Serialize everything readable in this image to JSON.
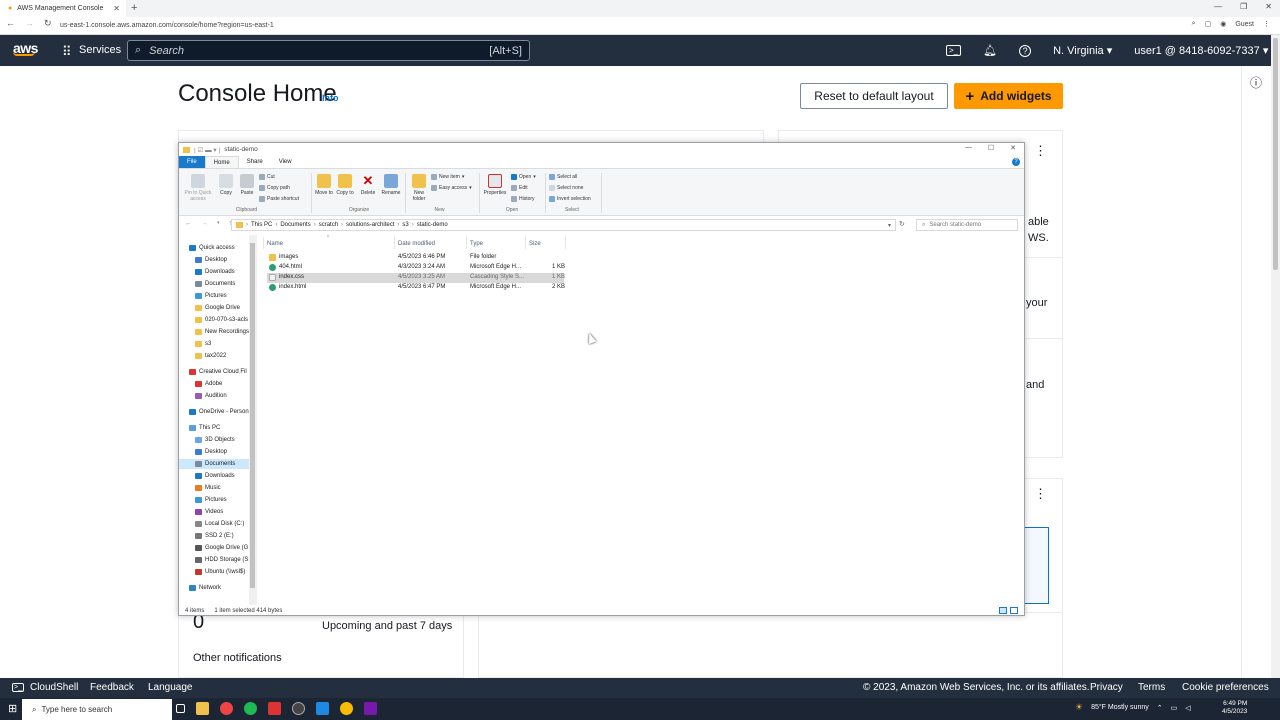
{
  "browser": {
    "tab_title": "AWS Management Console",
    "url": "us-east-1.console.aws.amazon.com/console/home?region=us-east-1",
    "profile": "Guest"
  },
  "aws_nav": {
    "logo": "aws",
    "services": "Services",
    "search_placeholder": "Search",
    "search_shortcut": "[Alt+S]",
    "region": "N. Virginia",
    "account": "user1 @ 8418-6092-7337"
  },
  "console": {
    "title": "Console Home",
    "info": "Info",
    "reset_button": "Reset to default layout",
    "add_widgets_button": "Add widgets",
    "fragment_1a": "able",
    "fragment_1b": "WS.",
    "fragment_2": "your",
    "fragment_3": "and",
    "health_count": "0",
    "upcoming": "Upcoming and past 7 days",
    "other_notifications": "Other notifications"
  },
  "footer": {
    "cloudshell": "CloudShell",
    "feedback": "Feedback",
    "language": "Language",
    "copyright": "© 2023, Amazon Web Services, Inc. or its affiliates.",
    "privacy": "Privacy",
    "terms": "Terms",
    "cookie": "Cookie preferences"
  },
  "taskbar": {
    "search_placeholder": "Type here to search",
    "weather": "85°F  Mostly sunny",
    "time": "6:49 PM",
    "date": "4/5/2023"
  },
  "explorer": {
    "title": "static-demo",
    "menu": [
      "File",
      "Home",
      "Share",
      "View"
    ],
    "ribbon": {
      "pin": "Pin to Quick access",
      "copy": "Copy",
      "paste": "Paste",
      "cut": "Cut",
      "copy_path": "Copy path",
      "paste_shortcut": "Paste shortcut",
      "move_to": "Move to",
      "copy_to": "Copy to",
      "delete": "Delete",
      "rename": "Rename",
      "new_item": "New item",
      "easy_access": "Easy access",
      "new_folder": "New folder",
      "properties": "Properties",
      "open": "Open",
      "edit": "Edit",
      "history": "History",
      "select_all": "Select all",
      "select_none": "Select none",
      "invert_selection": "Invert selection",
      "groups": [
        "Clipboard",
        "Organize",
        "New",
        "Open",
        "Select"
      ]
    },
    "breadcrumb": [
      "This PC",
      "Documents",
      "scratch",
      "solutions-architect",
      "s3",
      "static-demo"
    ],
    "search_placeholder": "Search static-demo",
    "columns": [
      "Name",
      "Date modified",
      "Type",
      "Size"
    ],
    "files": [
      {
        "name": "images",
        "date": "4/5/2023 6:46 PM",
        "type": "File folder",
        "size": ""
      },
      {
        "name": "404.html",
        "date": "4/3/2023 3:24 AM",
        "type": "Microsoft Edge H...",
        "size": "1 KB"
      },
      {
        "name": "index.css",
        "date": "4/5/2023 3:25 AM",
        "type": "Cascading Style S...",
        "size": "1 KB"
      },
      {
        "name": "index.html",
        "date": "4/5/2023 6:47 PM",
        "type": "Microsoft Edge H...",
        "size": "2 KB"
      }
    ],
    "nav": [
      "Quick access",
      "Desktop",
      "Downloads",
      "Documents",
      "Pictures",
      "Google Drive",
      "020-070-s3-acls",
      "New Recordings",
      "s3",
      "tax2022",
      "Creative Cloud Fil",
      "Adobe",
      "Audition",
      "OneDrive - Person",
      "This PC",
      "3D Objects",
      "Desktop",
      "Documents",
      "Downloads",
      "Music",
      "Pictures",
      "Videos",
      "Local Disk (C:)",
      "SSD 2 (E:)",
      "Google Drive (G:",
      "HDD Storage (S:",
      "Ubuntu (\\\\wsl$)",
      "Network"
    ],
    "status": {
      "items": "4 items",
      "selected": "1 item selected  414 bytes"
    }
  },
  "colors": {
    "aws_nav": "#232f3e",
    "aws_orange": "#ff9900",
    "link_blue": "#0972d3",
    "win_blue": "#1979ca"
  }
}
